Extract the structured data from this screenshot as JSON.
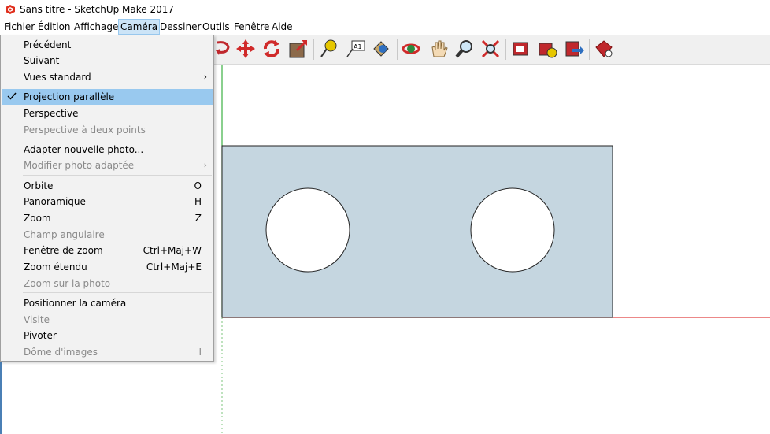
{
  "window": {
    "title": "Sans titre - SketchUp Make 2017",
    "icon": "sketchup-logo-icon"
  },
  "menubar": {
    "items": [
      {
        "label": "Fichier",
        "active": false
      },
      {
        "label": "Édition",
        "active": false
      },
      {
        "label": "Affichage",
        "active": false
      },
      {
        "label": "Caméra",
        "active": true
      },
      {
        "label": "Dessiner",
        "active": false
      },
      {
        "label": "Outils",
        "active": false
      },
      {
        "label": "Fenêtre",
        "active": false
      },
      {
        "label": "Aide",
        "active": false
      }
    ]
  },
  "toolbar": {
    "icons": [
      "lasso-select-icon",
      "move-icon",
      "rotate-icon",
      "scale-icon",
      "tape-measure-icon",
      "text-icon",
      "paint-bucket-icon",
      "orbit-icon",
      "pan-icon",
      "zoom-icon",
      "zoom-extents-icon",
      "warehouse-icon",
      "extension-warehouse-icon",
      "share-model-icon",
      "ruby-console-icon"
    ]
  },
  "camera_menu": {
    "items": [
      {
        "label": "Précédent",
        "shortcut": "",
        "disabled": false,
        "submenu": false,
        "checked": false
      },
      {
        "label": "Suivant",
        "shortcut": "",
        "disabled": false,
        "submenu": false,
        "checked": false
      },
      {
        "label": "Vues standard",
        "shortcut": "",
        "disabled": false,
        "submenu": true,
        "checked": false
      },
      {
        "label": "Projection parallèle",
        "shortcut": "",
        "disabled": false,
        "submenu": false,
        "checked": true
      },
      {
        "label": "Perspective",
        "shortcut": "",
        "disabled": false,
        "submenu": false,
        "checked": false
      },
      {
        "label": "Perspective à deux points",
        "shortcut": "",
        "disabled": true,
        "submenu": false,
        "checked": false
      },
      {
        "label": "Adapter nouvelle photo...",
        "shortcut": "",
        "disabled": false,
        "submenu": false,
        "checked": false
      },
      {
        "label": "Modifier photo adaptée",
        "shortcut": "",
        "disabled": true,
        "submenu": true,
        "checked": false
      },
      {
        "label": "Orbite",
        "shortcut": "O",
        "disabled": false,
        "submenu": false,
        "checked": false
      },
      {
        "label": "Panoramique",
        "shortcut": "H",
        "disabled": false,
        "submenu": false,
        "checked": false
      },
      {
        "label": "Zoom",
        "shortcut": "Z",
        "disabled": false,
        "submenu": false,
        "checked": false
      },
      {
        "label": "Champ angulaire",
        "shortcut": "",
        "disabled": true,
        "submenu": false,
        "checked": false
      },
      {
        "label": "Fenêtre de zoom",
        "shortcut": "Ctrl+Maj+W",
        "disabled": false,
        "submenu": false,
        "checked": false
      },
      {
        "label": "Zoom étendu",
        "shortcut": "Ctrl+Maj+E",
        "disabled": false,
        "submenu": false,
        "checked": false
      },
      {
        "label": "Zoom sur la photo",
        "shortcut": "",
        "disabled": true,
        "submenu": false,
        "checked": false
      },
      {
        "label": "Positionner la caméra",
        "shortcut": "",
        "disabled": false,
        "submenu": false,
        "checked": false
      },
      {
        "label": "Visite",
        "shortcut": "",
        "disabled": true,
        "submenu": false,
        "checked": false
      },
      {
        "label": "Pivoter",
        "shortcut": "",
        "disabled": false,
        "submenu": false,
        "checked": false
      },
      {
        "label": "Dôme d'images",
        "shortcut": "I",
        "disabled": true,
        "submenu": false,
        "checked": false
      }
    ]
  },
  "colors": {
    "menu_highlight": "#99c9ef",
    "menubar_active": "#cce4f7",
    "face_fill": "#c5d6e0",
    "green_axis": "#3cb043",
    "red_axis": "#e04040"
  }
}
